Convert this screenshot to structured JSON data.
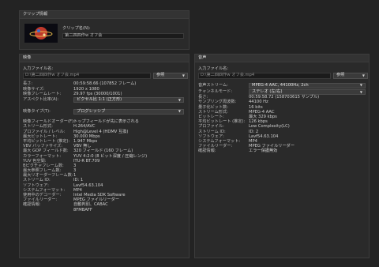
{
  "clip": {
    "header": "クリップ情報",
    "name_label": "クリップ名(N):",
    "name_value": "第二四四作w オフ会"
  },
  "video": {
    "header": "映像",
    "file_label": "入力ファイル名:",
    "file_value": "D:\\第二四四作w オフ会.mp4",
    "browse_label": "参照",
    "rows": [
      {
        "k": "長さ:",
        "v": "00:59:58.66 (107852 フレーム)"
      },
      {
        "k": "映像サイズ:",
        "v": "1920 x 1080"
      },
      {
        "k": "映像フレームレート:",
        "v": "29.97 fps (30000/1001)"
      },
      {
        "k": "アスペクト比率(A):",
        "v": "ピクセル比 1:1 (正方形)",
        "dropdown": true
      },
      {
        "k": "",
        "v": ""
      },
      {
        "k": "映像タイプ(T):",
        "v": "プログレッシブ",
        "dropdown": true
      },
      {
        "k": "",
        "v": ""
      },
      {
        "k": "映像フィールドオーダー(F):",
        "v": "トップフィールドが先に表示される"
      },
      {
        "k": "ストリーム形式:",
        "v": "H.264/AVC"
      },
      {
        "k": "プロファイル / レベル:",
        "v": "High@Level 4 (HDMV 互換)"
      },
      {
        "k": "最大ビットレート:",
        "v": "30.000 Mbps"
      },
      {
        "k": "平均ビットレート (推定):",
        "v": "1.947 Mbps"
      },
      {
        "k": "VBV バッファサイズ:",
        "v": "VBV 無し"
      },
      {
        "k": "最大 GOP フィールド数:",
        "v": "320 フィールド (160 フレーム)"
      },
      {
        "k": "カラーフォーマット:",
        "v": "YUV 4:2:0 (8 ビット深度 / 圧縮レンジ)"
      },
      {
        "k": "YUV 色空間:",
        "v": "ITU-R BT.709"
      },
      {
        "k": "Bピクチャフレーム数:",
        "v": "3"
      },
      {
        "k": "最大参照フレーム数:",
        "v": "3"
      },
      {
        "k": "最大リオーダーフレーム数:",
        "v": "1"
      },
      {
        "k": "ストリーム ID:",
        "v": "ID: 1"
      },
      {
        "k": "ソフトウェア:",
        "v": "Lavf54.63.104"
      },
      {
        "k": "システムフォーマット:",
        "v": "MP4"
      },
      {
        "k": "使用中のデコーダー:",
        "v": "Intel Media SDK Software"
      },
      {
        "k": "ファイルリーダー:",
        "v": "MPEG ファイルリーダー"
      },
      {
        "k": "確認情報:",
        "v": "自動判別、CABAC"
      }
    ],
    "last_extra": "8FMBAFF"
  },
  "audio": {
    "header": "音声",
    "file_label": "入力ファイル名:",
    "file_value": "D:\\第二四四作w オフ会.mp4",
    "browse_label": "参照",
    "rows": [
      {
        "k": "音声ストリーム:",
        "v": "MPEG-4 AAC, 44100Hz, 2ch",
        "dropdown": true
      },
      {
        "k": "チャンネルモード:",
        "v": "ステレオ (左/右)",
        "dropdown": true
      },
      {
        "k": "長さ:",
        "v": "00:59:58.72 (158703615 サンプル)"
      },
      {
        "k": "サンプリング周波数:",
        "v": "44100 Hz"
      },
      {
        "k": "量子化ビット数:",
        "v": "16 bits"
      },
      {
        "k": "ストリーム形式:",
        "v": "MPEG-4 AAC"
      },
      {
        "k": "ビットレート:",
        "v": "最大 329 kbps"
      },
      {
        "k": "平均ビットレート (推定):",
        "v": "126 kbps"
      },
      {
        "k": "プロファイル:",
        "v": "Low Complexity(LC)"
      },
      {
        "k": "ストリーム ID:",
        "v": "ID: 2"
      },
      {
        "k": "ソフトウェア:",
        "v": "Lavf54.63.104"
      },
      {
        "k": "システムフォーマット:",
        "v": "MP4"
      },
      {
        "k": "ファイルリーダー:",
        "v": "MPEG ファイルリーダー"
      },
      {
        "k": "確認情報:",
        "v": "エラー保護無効"
      }
    ]
  }
}
